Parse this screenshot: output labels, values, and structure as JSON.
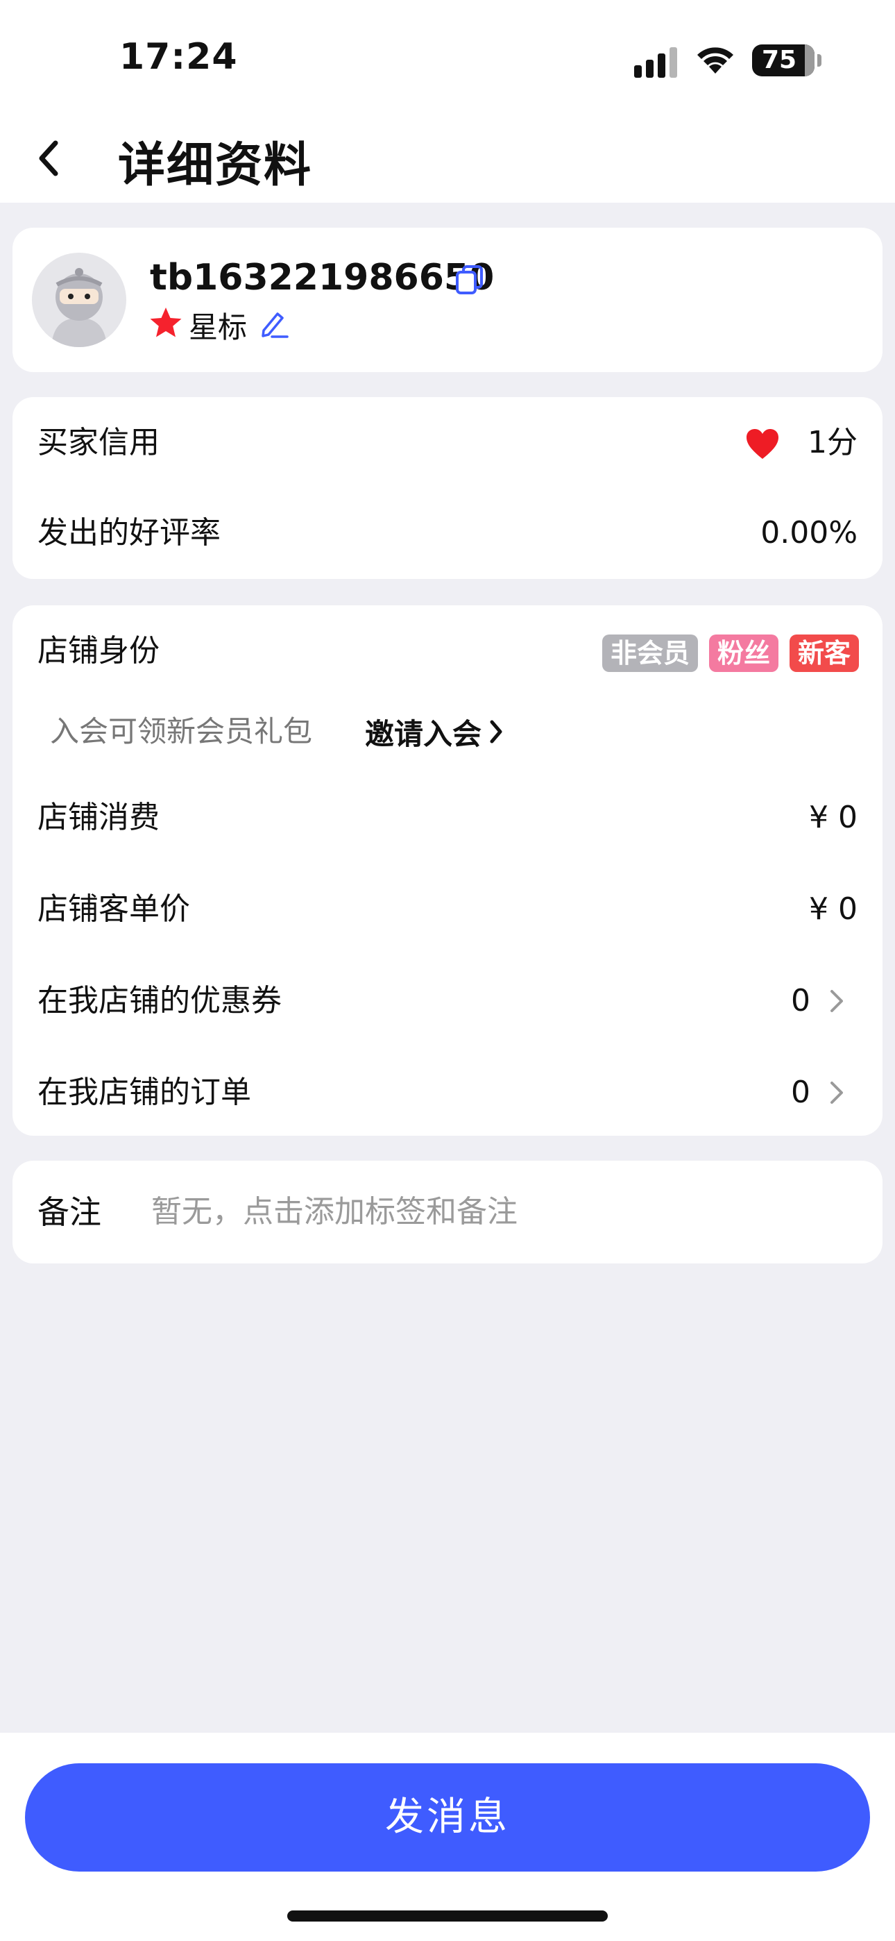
{
  "status_bar": {
    "time": "17:24",
    "battery": "75"
  },
  "header": {
    "title": "详细资料"
  },
  "profile": {
    "username": "tb163221986650",
    "star_label": "星标"
  },
  "credit": {
    "rows": [
      {
        "label": "买家信用",
        "value": "1分"
      },
      {
        "label": "发出的好评率",
        "value": "0.00%"
      }
    ]
  },
  "shop": {
    "identity_label": "店铺身份",
    "badges": [
      {
        "text": "非会员",
        "color": "#b3b3b8"
      },
      {
        "text": "粉丝",
        "color": "#f47aa0"
      },
      {
        "text": "新客",
        "color": "#f24b4b"
      }
    ],
    "invite_hint": "入会可领新会员礼包",
    "invite_link": "邀请入会",
    "rows": [
      {
        "label": "店铺消费",
        "value": "¥ 0"
      },
      {
        "label": "店铺客单价",
        "value": "¥ 0"
      },
      {
        "label": "在我店铺的优惠券",
        "value": "0"
      },
      {
        "label": "在我店铺的订单",
        "value": "0"
      }
    ]
  },
  "remark": {
    "label": "备注",
    "placeholder": "暂无，点击添加标签和备注"
  },
  "actions": {
    "send_message": "发消息"
  },
  "colors": {
    "accent": "#3f5cff",
    "star": "#f5222d",
    "icon_blue": "#3f5cff"
  }
}
